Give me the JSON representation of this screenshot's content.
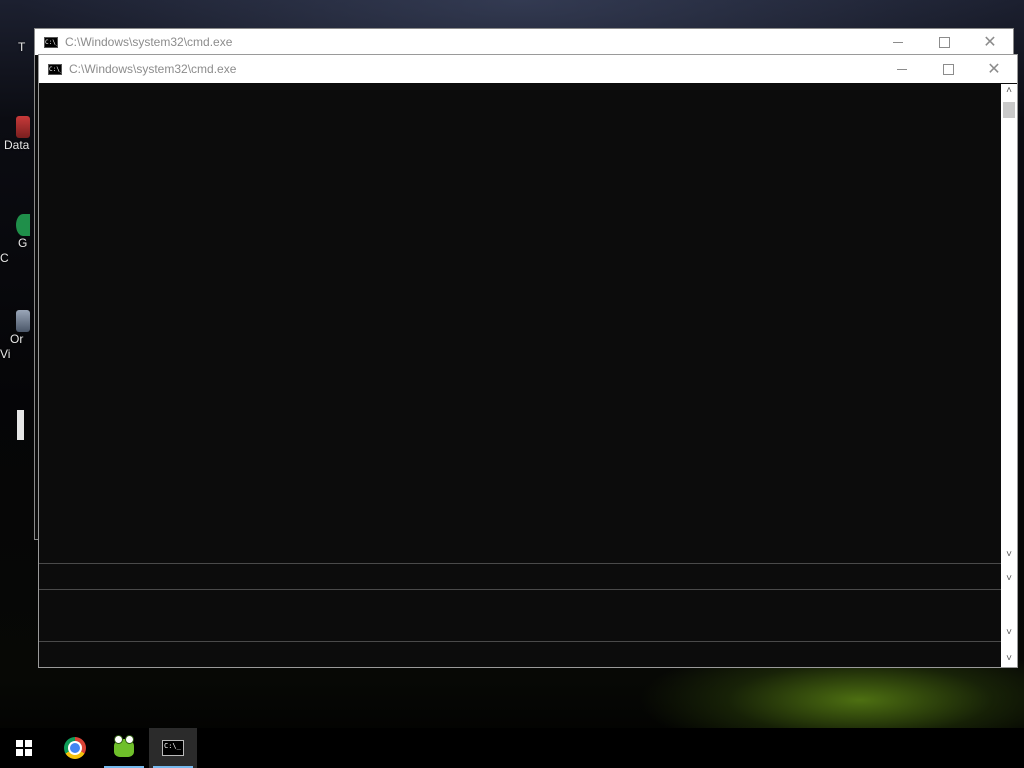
{
  "desktop": {
    "icons": [
      {
        "label": "T",
        "icon": "shortcut-icon"
      },
      {
        "label": "Data",
        "icon": "data-app-icon"
      },
      {
        "label": "G\nC",
        "icon": "green-app-icon"
      },
      {
        "label": "Or\nVi",
        "icon": "oracle-vm-icon"
      }
    ]
  },
  "back_window": {
    "title": "C:\\Windows\\system32\\cmd.exe",
    "icon": "cmd-icon"
  },
  "front_window": {
    "title": "C:\\Windows\\system32\\cmd.exe",
    "icon": "cmd-icon",
    "icon_text": "C:\\_",
    "console_text": "",
    "background_color": "#0c0c0c"
  },
  "caption_buttons": {
    "minimize": "minimize-icon",
    "maximize": "maximize-icon",
    "close": "close-icon",
    "close_glyph": "✕"
  },
  "scrollbar": {
    "up_arrow": "˄",
    "down_arrow": "˅"
  },
  "taskbar": {
    "items": [
      {
        "name": "start",
        "icon": "windows-start-icon",
        "active": false
      },
      {
        "name": "chrome",
        "icon": "chrome-icon",
        "active": false
      },
      {
        "name": "frog-app",
        "icon": "frog-app-icon",
        "active": false
      },
      {
        "name": "cmd",
        "icon": "cmd-icon",
        "active": true,
        "icon_text": "C:\\_"
      }
    ],
    "accent_color": "#76b9ed"
  }
}
